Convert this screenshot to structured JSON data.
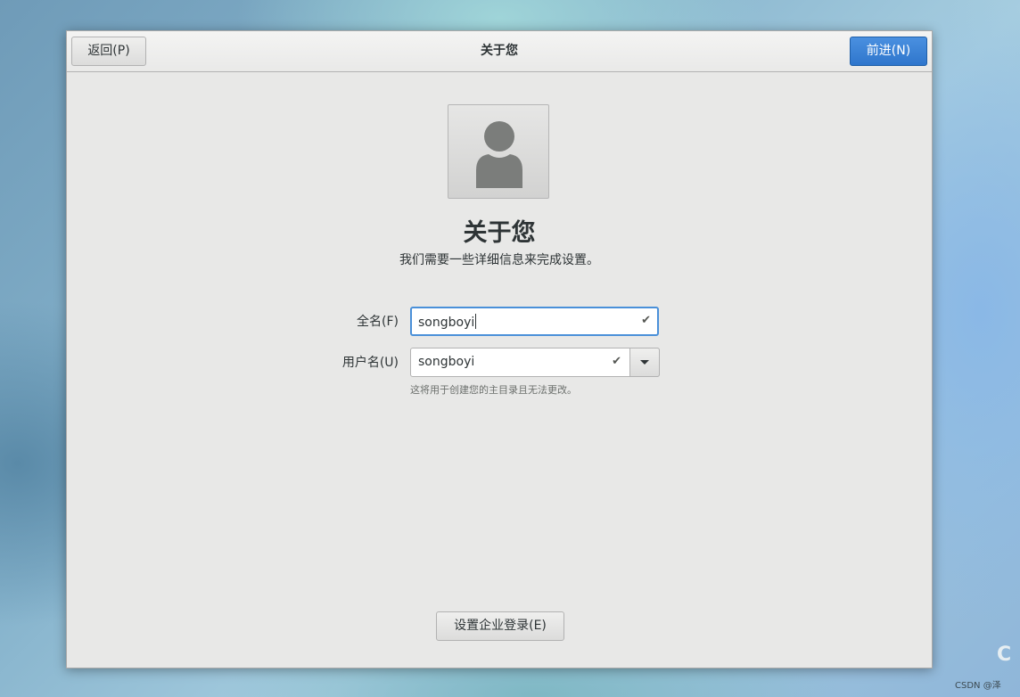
{
  "header": {
    "back_label": "返回(P)",
    "title": "关于您",
    "next_label": "前进(N)",
    "next_color": "#3a82d6"
  },
  "main": {
    "avatar_icon": "user-avatar-icon",
    "heading": "关于您",
    "subtitle": "我们需要一些详细信息来完成设置。",
    "fullname": {
      "label": "全名(F)",
      "value": "songboyi",
      "status_icon": "checkmark-icon"
    },
    "username": {
      "label": "用户名(U)",
      "value": "songboyi",
      "status_icon": "checkmark-icon",
      "hint": "这将用于创建您的主目录且无法更改。"
    },
    "enterprise_login_label": "设置企业登录(E)"
  },
  "watermark": {
    "letter": "C",
    "text": "CSDN @泽"
  }
}
